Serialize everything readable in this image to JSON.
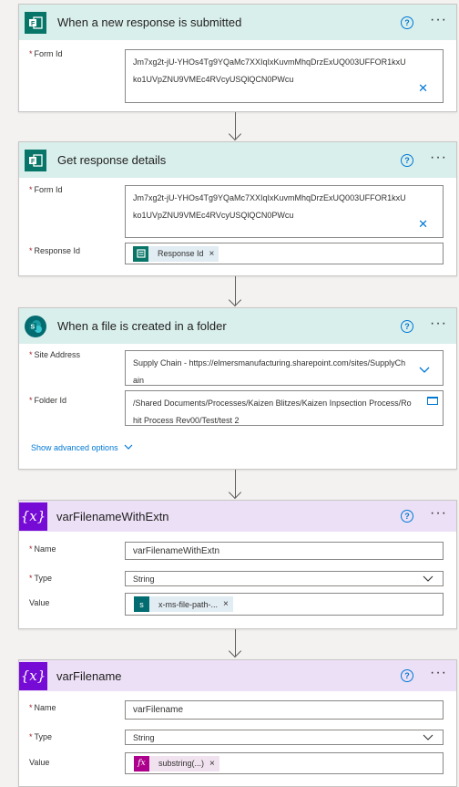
{
  "cards": [
    {
      "title": "When a new response is submitted",
      "fields": [
        {
          "label": "Form Id",
          "value": "Jm7xg2t-jU-YHOs4Tg9YQaMc7XXIqIxKuvmMhqDrzExUQ003UFFOR1kxUko1UVpZNU9VMEc4RVcyUSQlQCN0PWcu"
        }
      ]
    },
    {
      "title": "Get response details",
      "fields": [
        {
          "label": "Form Id",
          "value": "Jm7xg2t-jU-YHOs4Tg9YQaMc7XXIqIxKuvmMhqDrzExUQ003UFFOR1kxUko1UVpZNU9VMEc4RVcyUSQlQCN0PWcu"
        },
        {
          "label": "Response Id",
          "token": "Response Id"
        }
      ]
    },
    {
      "title": "When a file is created in a folder",
      "fields": [
        {
          "label": "Site Address",
          "value": "Supply Chain - https://elmersmanufacturing.sharepoint.com/sites/SupplyChain"
        },
        {
          "label": "Folder Id",
          "value": "/Shared Documents/Processes/Kaizen Blitzes/Kaizen Inpsection Process/Rohit Process Rev00/Test/test 2"
        }
      ],
      "advanced": "Show advanced options"
    },
    {
      "title": "varFilenameWithExtn",
      "fields": [
        {
          "label": "Name",
          "value": "varFilenameWithExtn"
        },
        {
          "label": "Type",
          "value": "String"
        },
        {
          "label": "Value",
          "token": "x-ms-file-path-..."
        }
      ]
    },
    {
      "title": "varFilename",
      "fields": [
        {
          "label": "Name",
          "value": "varFilename"
        },
        {
          "label": "Type",
          "value": "String"
        },
        {
          "label": "Value",
          "token": "substring(...)"
        }
      ]
    }
  ],
  "glyphs": {
    "help": "?",
    "more": "···",
    "close": "✕",
    "token_close": "×",
    "chevron": "⌵",
    "var_icon": "{x}",
    "fx": "fx"
  },
  "colors": {
    "forms": "#077568",
    "sharepoint": "#036c70",
    "variable": "#770bd6",
    "expression": "#ad008c",
    "link": "#0078d4"
  }
}
